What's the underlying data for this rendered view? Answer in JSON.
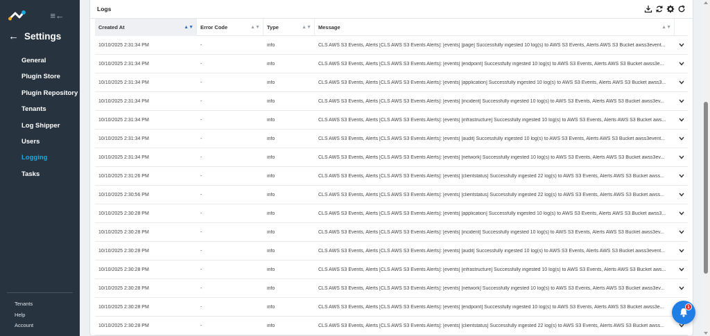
{
  "sidebar": {
    "back_label": "Settings",
    "items": [
      {
        "label": "General"
      },
      {
        "label": "Plugin Store"
      },
      {
        "label": "Plugin Repository"
      },
      {
        "label": "Tenants"
      },
      {
        "label": "Log Shipper"
      },
      {
        "label": "Users"
      },
      {
        "label": "Logging"
      },
      {
        "label": "Tasks"
      }
    ],
    "active_item": "Logging",
    "footer": [
      {
        "label": "Tenants"
      },
      {
        "label": "Help"
      },
      {
        "label": "Account"
      }
    ]
  },
  "colors": {
    "sidebar_bg": "#27333e",
    "accent": "#1aa9e0",
    "fab": "#1f7de6",
    "badge": "#e02424"
  },
  "card": {
    "title": "Logs",
    "actions": [
      "download-icon",
      "sync-icon",
      "gear-icon",
      "refresh-icon"
    ]
  },
  "table": {
    "columns": [
      "Created At",
      "Error Code",
      "Type",
      "Message"
    ],
    "sorted_column": "Created At",
    "rows": [
      {
        "created": "10/10/2025 2:31:34 PM",
        "code": "-",
        "type": "info",
        "message": "CLS AWS S3 Events, Alerts [CLS AWS S3 Events Alerts]: [events] [page] Successfully ingested 10 log(s) to AWS S3 Events, Alerts AWS S3 Bucket awss3event..."
      },
      {
        "created": "10/10/2025 2:31:34 PM",
        "code": "-",
        "type": "info",
        "message": "CLS AWS S3 Events, Alerts [CLS AWS S3 Events Alerts]: [events] [endpoint] Successfully ingested 10 log(s) to AWS S3 Events, Alerts AWS S3 Bucket awss3e..."
      },
      {
        "created": "10/10/2025 2:31:34 PM",
        "code": "-",
        "type": "info",
        "message": "CLS AWS S3 Events, Alerts [CLS AWS S3 Events Alerts]: [events] [application] Successfully ingested 10 log(s) to AWS S3 Events, Alerts AWS S3 Bucket awss3..."
      },
      {
        "created": "10/10/2025 2:31:34 PM",
        "code": "-",
        "type": "info",
        "message": "CLS AWS S3 Events, Alerts [CLS AWS S3 Events Alerts]: [events] [incident] Successfully ingested 10 log(s) to AWS S3 Events, Alerts AWS S3 Bucket awss3ev..."
      },
      {
        "created": "10/10/2025 2:31:34 PM",
        "code": "-",
        "type": "info",
        "message": "CLS AWS S3 Events, Alerts [CLS AWS S3 Events Alerts]: [events] [infrastructure] Successfully ingested 10 log(s) to AWS S3 Events, Alerts AWS S3 Bucket aws..."
      },
      {
        "created": "10/10/2025 2:31:34 PM",
        "code": "-",
        "type": "info",
        "message": "CLS AWS S3 Events, Alerts [CLS AWS S3 Events Alerts]: [events] [audit] Successfully ingested 10 log(s) to AWS S3 Events, Alerts AWS S3 Bucket awss3event..."
      },
      {
        "created": "10/10/2025 2:31:34 PM",
        "code": "-",
        "type": "info",
        "message": "CLS AWS S3 Events, Alerts [CLS AWS S3 Events Alerts]: [events] [network] Successfully ingested 10 log(s) to AWS S3 Events, Alerts AWS S3 Bucket awss3ev..."
      },
      {
        "created": "10/10/2025 2:31:26 PM",
        "code": "-",
        "type": "info",
        "message": "CLS AWS S3 Events, Alerts [CLS AWS S3 Events Alerts]: [events] [clientstatus] Successfully ingested 22 log(s) to AWS S3 Events, Alerts AWS S3 Bucket awss..."
      },
      {
        "created": "10/10/2025 2:30:56 PM",
        "code": "-",
        "type": "info",
        "message": "CLS AWS S3 Events, Alerts [CLS AWS S3 Events Alerts]: [events] [clientstatus] Successfully ingested 22 log(s) to AWS S3 Events, Alerts AWS S3 Bucket awss..."
      },
      {
        "created": "10/10/2025 2:30:28 PM",
        "code": "-",
        "type": "info",
        "message": "CLS AWS S3 Events, Alerts [CLS AWS S3 Events Alerts]: [events] [application] Successfully ingested 10 log(s) to AWS S3 Events, Alerts AWS S3 Bucket awss3..."
      },
      {
        "created": "10/10/2025 2:30:28 PM",
        "code": "-",
        "type": "info",
        "message": "CLS AWS S3 Events, Alerts [CLS AWS S3 Events Alerts]: [events] [incident] Successfully ingested 10 log(s) to AWS S3 Events, Alerts AWS S3 Bucket awss3ev..."
      },
      {
        "created": "10/10/2025 2:30:28 PM",
        "code": "-",
        "type": "info",
        "message": "CLS AWS S3 Events, Alerts [CLS AWS S3 Events Alerts]: [events] [audit] Successfully ingested 10 log(s) to AWS S3 Events, Alerts AWS S3 Bucket awss3event..."
      },
      {
        "created": "10/10/2025 2:30:28 PM",
        "code": "-",
        "type": "info",
        "message": "CLS AWS S3 Events, Alerts [CLS AWS S3 Events Alerts]: [events] [infrastructure] Successfully ingested 10 log(s) to AWS S3 Events, Alerts AWS S3 Bucket aws..."
      },
      {
        "created": "10/10/2025 2:30:28 PM",
        "code": "-",
        "type": "info",
        "message": "CLS AWS S3 Events, Alerts [CLS AWS S3 Events Alerts]: [events] [network] Successfully ingested 10 log(s) to AWS S3 Events, Alerts AWS S3 Bucket awss3ev..."
      },
      {
        "created": "10/10/2025 2:30:28 PM",
        "code": "-",
        "type": "info",
        "message": "CLS AWS S3 Events, Alerts [CLS AWS S3 Events Alerts]: [events] [endpoint] Successfully ingested 10 log(s) to AWS S3 Events, Alerts AWS S3 Bucket awss3e..."
      },
      {
        "created": "10/10/2025 2:30:28 PM",
        "code": "-",
        "type": "info",
        "message": "CLS AWS S3 Events, Alerts [CLS AWS S3 Events Alerts]: [events] [clientstatus] Successfully ingested 22 log(s) to AWS S3 Events, Alerts AWS S3 Bucket awss..."
      }
    ]
  },
  "notifications": {
    "count": "1"
  }
}
